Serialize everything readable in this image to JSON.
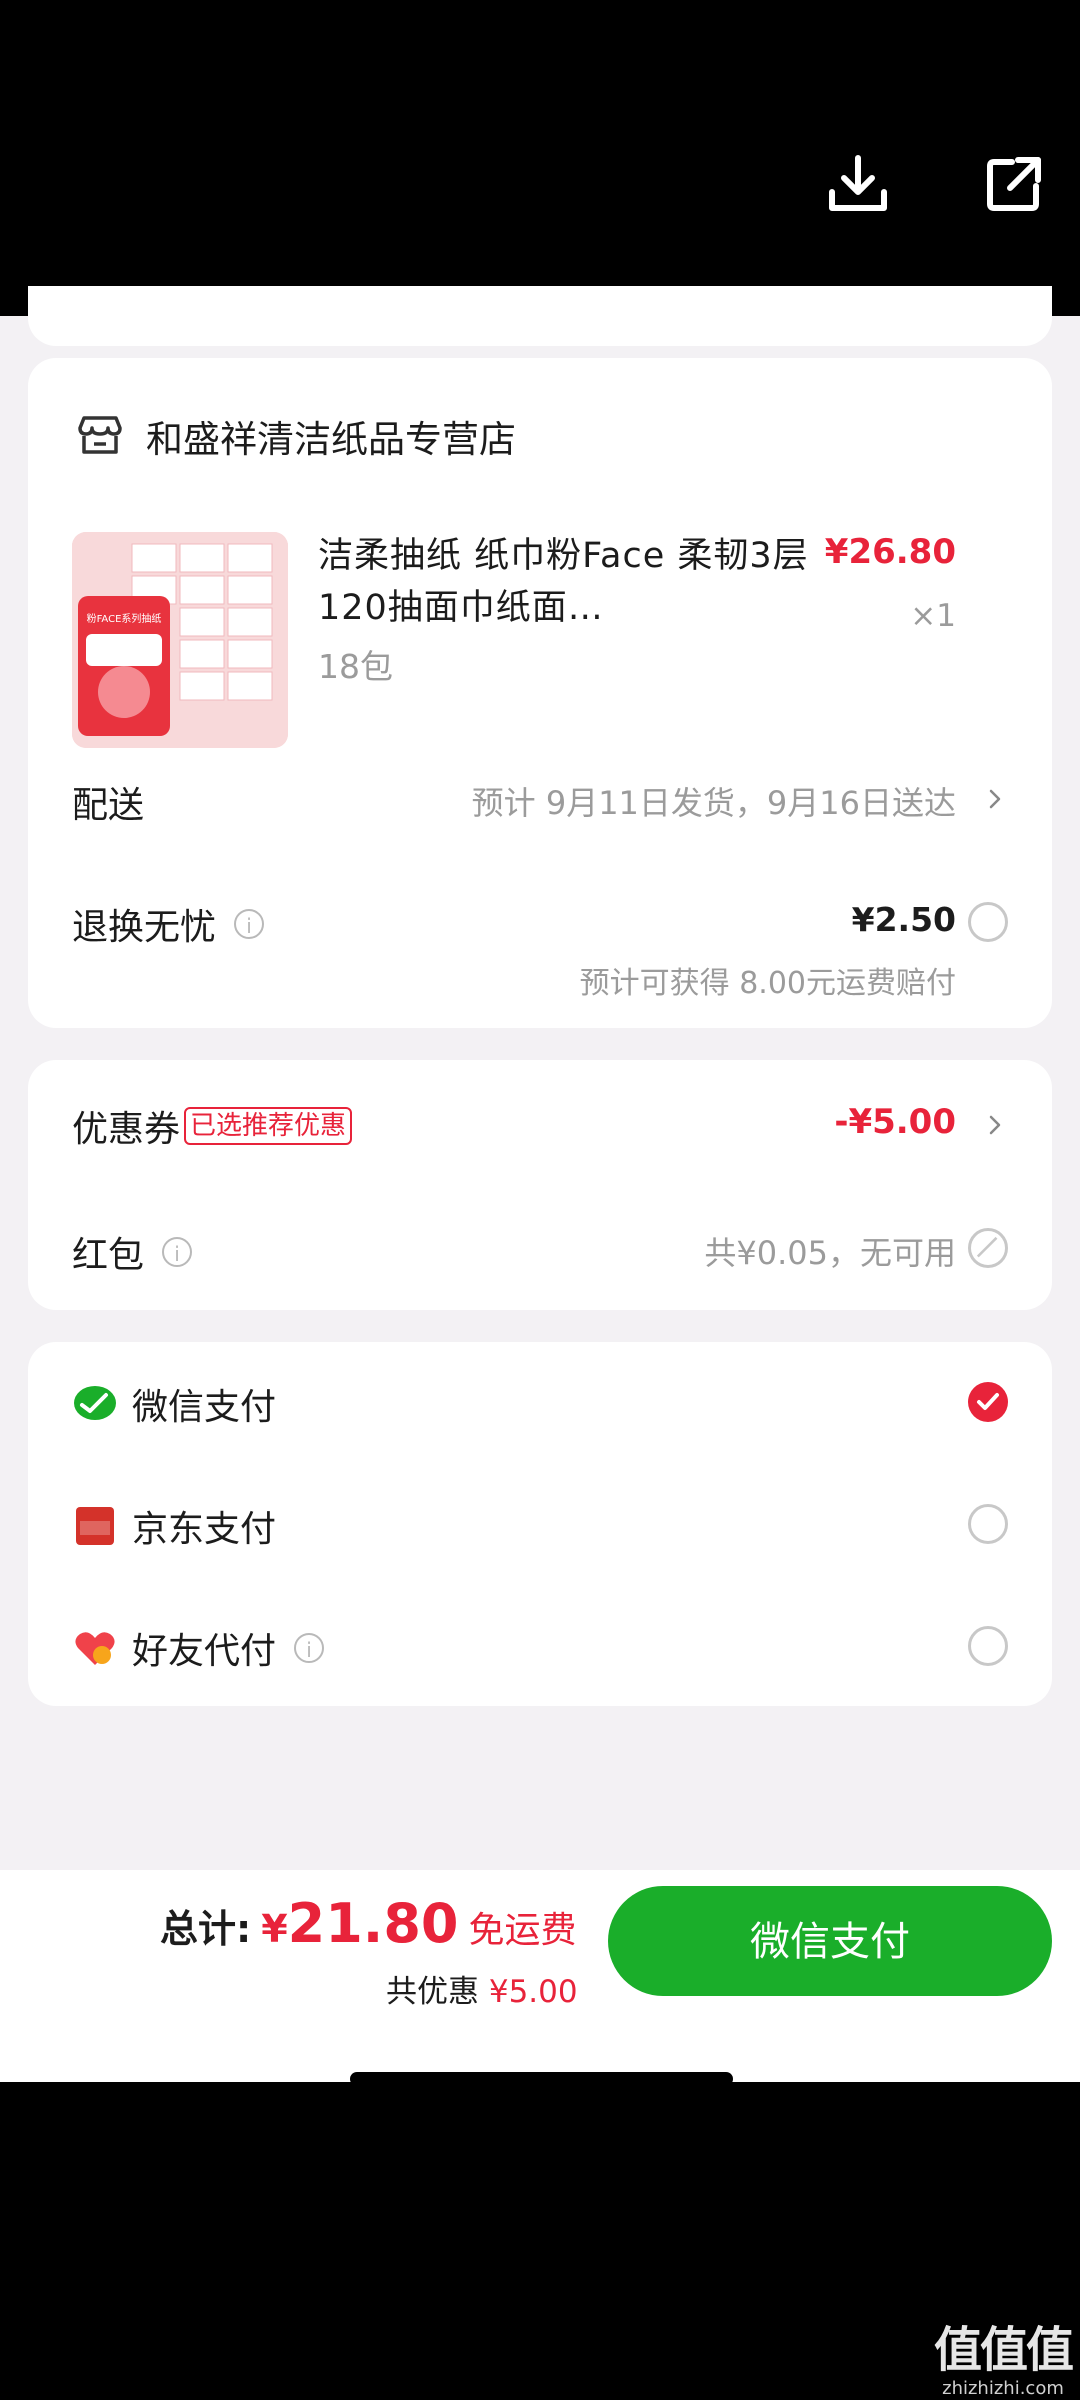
{
  "topbar": {
    "icons": [
      "download-icon",
      "share-icon"
    ]
  },
  "shop": {
    "name": "和盛祥清洁纸品专营店",
    "product": {
      "title": "洁柔抽纸  纸巾粉Face 柔韧3层120抽面巾纸面…",
      "spec": "18包",
      "price": "¥26.80",
      "qty": "×1",
      "thumb_badge": "粉FACE系列抽纸"
    },
    "delivery": {
      "label": "配送",
      "value": "预计 9月11日发货，9月16日送达"
    },
    "return_insurance": {
      "label": "退换无忧",
      "price": "¥2.50",
      "note": "预计可获得 8.00元运费赔付"
    }
  },
  "discounts": {
    "coupon": {
      "label": "优惠券",
      "tag": "已选推荐优惠",
      "value": "-¥5.00"
    },
    "red_packet": {
      "label": "红包",
      "value": "共¥0.05，无可用"
    }
  },
  "payment_methods": [
    {
      "label": "微信支付",
      "icon": "wechat-pay-icon",
      "selected": true
    },
    {
      "label": "京东支付",
      "icon": "jd-pay-icon",
      "selected": false
    },
    {
      "label": "好友代付",
      "icon": "friend-pay-icon",
      "selected": false
    }
  ],
  "footer": {
    "total_label": "总计:",
    "currency": "¥",
    "total_amount": "21.80",
    "shipping": "免运费",
    "discount_label": "共优惠",
    "discount_value": "¥5.00",
    "pay_button": "微信支付"
  },
  "watermark": {
    "glyphs": "值值值",
    "url": "zhizhizhi.com"
  },
  "colors": {
    "accent": "#e8233a",
    "pay_green": "#1aae2a",
    "background": "#f3f1f4"
  }
}
